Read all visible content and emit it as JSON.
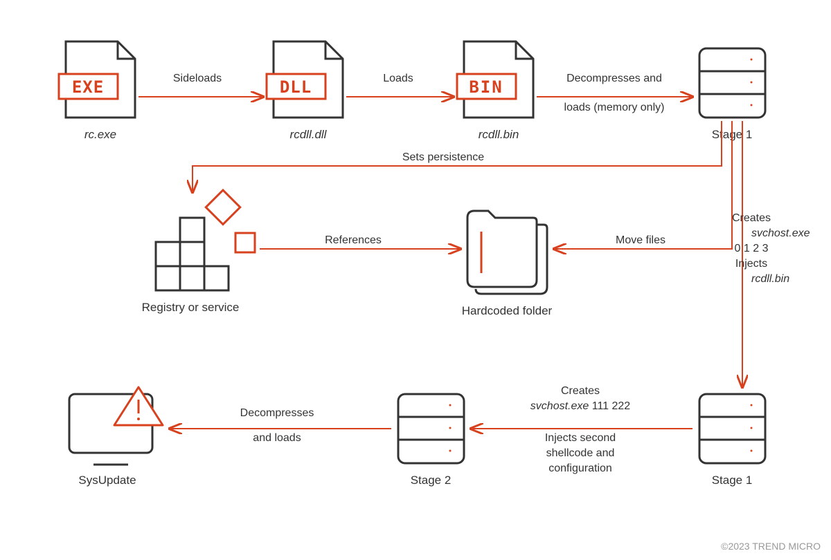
{
  "nodes": {
    "exe": {
      "badge": "EXE",
      "caption": "rc.exe"
    },
    "dll": {
      "badge": "DLL",
      "caption": "rcdll.dll"
    },
    "bin": {
      "badge": "BIN",
      "caption": "rcdll.bin"
    },
    "stage1_top": {
      "caption": "Stage 1"
    },
    "registry": {
      "caption": "Registry or service"
    },
    "folder": {
      "caption": "Hardcoded folder"
    },
    "stage1_bottom": {
      "caption": "Stage 1"
    },
    "stage2": {
      "caption": "Stage 2"
    },
    "sysupdate": {
      "caption": "SysUpdate"
    }
  },
  "edges": {
    "sideloads": "Sideloads",
    "loads": "Loads",
    "decompresses_loads_mem": {
      "line1": "Decompresses and",
      "line2": "loads (memory only)"
    },
    "sets_persistence": "Sets persistence",
    "references": "References",
    "move_files": "Move files",
    "creates_injects": {
      "l1": "Creates",
      "l2": "svchost.exe",
      "l3": "0 1 2 3",
      "l4": "Injects",
      "l5": "rcdll.bin"
    },
    "creates_second": {
      "l1": "Creates",
      "l2": "svchost.exe",
      "l25": "111 222",
      "l3": "Injects second",
      "l4": "shellcode and",
      "l5": "configuration"
    },
    "decompresses_loads": {
      "line1": "Decompresses",
      "line2": "and loads"
    }
  },
  "copyright": "©2023 TREND MICRO"
}
